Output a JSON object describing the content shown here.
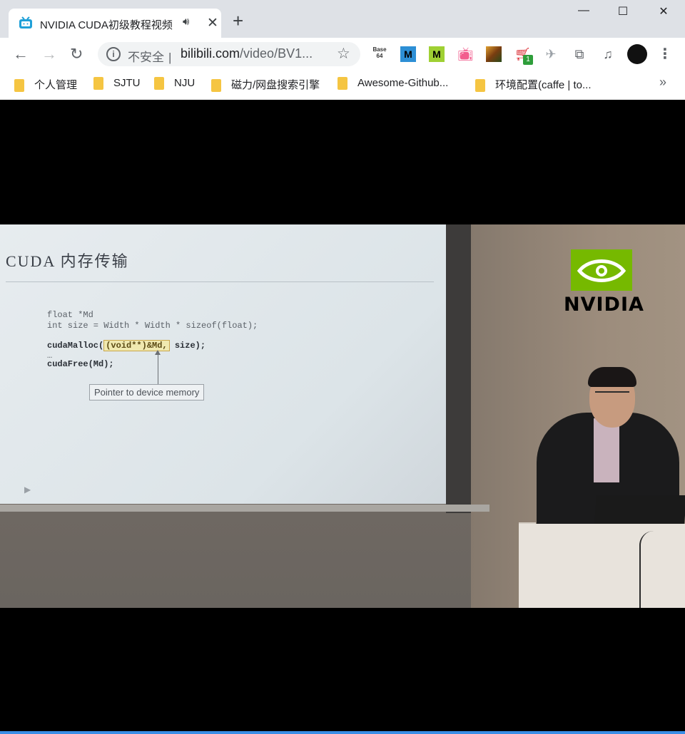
{
  "browser": {
    "tab": {
      "title": "NVIDIA CUDA初级教程视频",
      "audio_icon": "speaker-icon",
      "close_symbol": "✕"
    },
    "new_tab_symbol": "+",
    "window_controls": {
      "minimize": "—",
      "maximize": "☐",
      "close": "✕"
    },
    "nav": {
      "back": "←",
      "forward": "→",
      "reload": "↻"
    },
    "omnibox": {
      "security_label": "不安全",
      "separator": "|",
      "url_host": "bilibili.com",
      "url_path": "/video/BV1..."
    },
    "extensions": [
      {
        "name": "base64-extension-icon",
        "text": "Base 64"
      },
      {
        "name": "mendeley-extension-icon",
        "text": "M"
      },
      {
        "name": "m-extension-icon",
        "text": "M"
      },
      {
        "name": "bilibili-extension-icon",
        "text": ""
      },
      {
        "name": "image-extension-icon",
        "text": ""
      },
      {
        "name": "cart-extension-icon",
        "text": "1"
      },
      {
        "name": "bird-extension-icon",
        "text": ""
      },
      {
        "name": "puzzle-extensions-icon",
        "text": ""
      },
      {
        "name": "media-control-icon",
        "text": ""
      }
    ],
    "bookmarks": [
      "个人管理",
      "SJTU",
      "NJU",
      "磁力/网盘搜索引擎",
      "Awesome-Github...",
      "环境配置(caffe | to..."
    ],
    "bookmarks_more": "»"
  },
  "slide": {
    "title": "CUDA 内存传输",
    "code_lines": [
      "float *Md",
      "int size = Width * Width * sizeof(float);",
      "cudaMalloc(",
      "(void**)&Md,",
      " size);",
      "…",
      "cudaFree(Md);"
    ],
    "callout": "Pointer to device memory"
  },
  "video_logo": {
    "brand": "NVIDIA",
    "brand_color": "#76b900"
  }
}
